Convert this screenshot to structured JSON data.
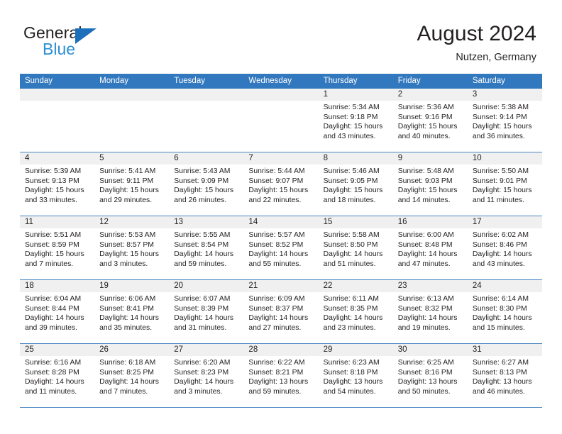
{
  "brand": {
    "name_part1": "General",
    "name_part2": "Blue",
    "triangle_icon": "blue-triangle-icon",
    "colors": {
      "dark": "#231f20",
      "blue": "#2b8fd4",
      "triangle": "#1c6fba"
    }
  },
  "header": {
    "title": "August 2024",
    "subtitle": "Nutzen, Germany"
  },
  "colors": {
    "header_row_bg": "#3278be",
    "header_row_text": "#ffffff",
    "daynum_bg": "#f0f0f0",
    "week_separator": "#4a87c4",
    "cell_text": "#231f20"
  },
  "weekdays": [
    "Sunday",
    "Monday",
    "Tuesday",
    "Wednesday",
    "Thursday",
    "Friday",
    "Saturday"
  ],
  "weeks": [
    {
      "daynums": [
        "",
        "",
        "",
        "",
        "1",
        "2",
        "3"
      ],
      "cells": [
        {
          "day": "",
          "sunrise": "",
          "sunset": "",
          "daylight_line1": "",
          "daylight_line2": ""
        },
        {
          "day": "",
          "sunrise": "",
          "sunset": "",
          "daylight_line1": "",
          "daylight_line2": ""
        },
        {
          "day": "",
          "sunrise": "",
          "sunset": "",
          "daylight_line1": "",
          "daylight_line2": ""
        },
        {
          "day": "",
          "sunrise": "",
          "sunset": "",
          "daylight_line1": "",
          "daylight_line2": ""
        },
        {
          "day": "1",
          "sunrise": "Sunrise: 5:34 AM",
          "sunset": "Sunset: 9:18 PM",
          "daylight_line1": "Daylight: 15 hours",
          "daylight_line2": "and 43 minutes."
        },
        {
          "day": "2",
          "sunrise": "Sunrise: 5:36 AM",
          "sunset": "Sunset: 9:16 PM",
          "daylight_line1": "Daylight: 15 hours",
          "daylight_line2": "and 40 minutes."
        },
        {
          "day": "3",
          "sunrise": "Sunrise: 5:38 AM",
          "sunset": "Sunset: 9:14 PM",
          "daylight_line1": "Daylight: 15 hours",
          "daylight_line2": "and 36 minutes."
        }
      ]
    },
    {
      "daynums": [
        "4",
        "5",
        "6",
        "7",
        "8",
        "9",
        "10"
      ],
      "cells": [
        {
          "day": "4",
          "sunrise": "Sunrise: 5:39 AM",
          "sunset": "Sunset: 9:13 PM",
          "daylight_line1": "Daylight: 15 hours",
          "daylight_line2": "and 33 minutes."
        },
        {
          "day": "5",
          "sunrise": "Sunrise: 5:41 AM",
          "sunset": "Sunset: 9:11 PM",
          "daylight_line1": "Daylight: 15 hours",
          "daylight_line2": "and 29 minutes."
        },
        {
          "day": "6",
          "sunrise": "Sunrise: 5:43 AM",
          "sunset": "Sunset: 9:09 PM",
          "daylight_line1": "Daylight: 15 hours",
          "daylight_line2": "and 26 minutes."
        },
        {
          "day": "7",
          "sunrise": "Sunrise: 5:44 AM",
          "sunset": "Sunset: 9:07 PM",
          "daylight_line1": "Daylight: 15 hours",
          "daylight_line2": "and 22 minutes."
        },
        {
          "day": "8",
          "sunrise": "Sunrise: 5:46 AM",
          "sunset": "Sunset: 9:05 PM",
          "daylight_line1": "Daylight: 15 hours",
          "daylight_line2": "and 18 minutes."
        },
        {
          "day": "9",
          "sunrise": "Sunrise: 5:48 AM",
          "sunset": "Sunset: 9:03 PM",
          "daylight_line1": "Daylight: 15 hours",
          "daylight_line2": "and 14 minutes."
        },
        {
          "day": "10",
          "sunrise": "Sunrise: 5:50 AM",
          "sunset": "Sunset: 9:01 PM",
          "daylight_line1": "Daylight: 15 hours",
          "daylight_line2": "and 11 minutes."
        }
      ]
    },
    {
      "daynums": [
        "11",
        "12",
        "13",
        "14",
        "15",
        "16",
        "17"
      ],
      "cells": [
        {
          "day": "11",
          "sunrise": "Sunrise: 5:51 AM",
          "sunset": "Sunset: 8:59 PM",
          "daylight_line1": "Daylight: 15 hours",
          "daylight_line2": "and 7 minutes."
        },
        {
          "day": "12",
          "sunrise": "Sunrise: 5:53 AM",
          "sunset": "Sunset: 8:57 PM",
          "daylight_line1": "Daylight: 15 hours",
          "daylight_line2": "and 3 minutes."
        },
        {
          "day": "13",
          "sunrise": "Sunrise: 5:55 AM",
          "sunset": "Sunset: 8:54 PM",
          "daylight_line1": "Daylight: 14 hours",
          "daylight_line2": "and 59 minutes."
        },
        {
          "day": "14",
          "sunrise": "Sunrise: 5:57 AM",
          "sunset": "Sunset: 8:52 PM",
          "daylight_line1": "Daylight: 14 hours",
          "daylight_line2": "and 55 minutes."
        },
        {
          "day": "15",
          "sunrise": "Sunrise: 5:58 AM",
          "sunset": "Sunset: 8:50 PM",
          "daylight_line1": "Daylight: 14 hours",
          "daylight_line2": "and 51 minutes."
        },
        {
          "day": "16",
          "sunrise": "Sunrise: 6:00 AM",
          "sunset": "Sunset: 8:48 PM",
          "daylight_line1": "Daylight: 14 hours",
          "daylight_line2": "and 47 minutes."
        },
        {
          "day": "17",
          "sunrise": "Sunrise: 6:02 AM",
          "sunset": "Sunset: 8:46 PM",
          "daylight_line1": "Daylight: 14 hours",
          "daylight_line2": "and 43 minutes."
        }
      ]
    },
    {
      "daynums": [
        "18",
        "19",
        "20",
        "21",
        "22",
        "23",
        "24"
      ],
      "cells": [
        {
          "day": "18",
          "sunrise": "Sunrise: 6:04 AM",
          "sunset": "Sunset: 8:44 PM",
          "daylight_line1": "Daylight: 14 hours",
          "daylight_line2": "and 39 minutes."
        },
        {
          "day": "19",
          "sunrise": "Sunrise: 6:06 AM",
          "sunset": "Sunset: 8:41 PM",
          "daylight_line1": "Daylight: 14 hours",
          "daylight_line2": "and 35 minutes."
        },
        {
          "day": "20",
          "sunrise": "Sunrise: 6:07 AM",
          "sunset": "Sunset: 8:39 PM",
          "daylight_line1": "Daylight: 14 hours",
          "daylight_line2": "and 31 minutes."
        },
        {
          "day": "21",
          "sunrise": "Sunrise: 6:09 AM",
          "sunset": "Sunset: 8:37 PM",
          "daylight_line1": "Daylight: 14 hours",
          "daylight_line2": "and 27 minutes."
        },
        {
          "day": "22",
          "sunrise": "Sunrise: 6:11 AM",
          "sunset": "Sunset: 8:35 PM",
          "daylight_line1": "Daylight: 14 hours",
          "daylight_line2": "and 23 minutes."
        },
        {
          "day": "23",
          "sunrise": "Sunrise: 6:13 AM",
          "sunset": "Sunset: 8:32 PM",
          "daylight_line1": "Daylight: 14 hours",
          "daylight_line2": "and 19 minutes."
        },
        {
          "day": "24",
          "sunrise": "Sunrise: 6:14 AM",
          "sunset": "Sunset: 8:30 PM",
          "daylight_line1": "Daylight: 14 hours",
          "daylight_line2": "and 15 minutes."
        }
      ]
    },
    {
      "daynums": [
        "25",
        "26",
        "27",
        "28",
        "29",
        "30",
        "31"
      ],
      "cells": [
        {
          "day": "25",
          "sunrise": "Sunrise: 6:16 AM",
          "sunset": "Sunset: 8:28 PM",
          "daylight_line1": "Daylight: 14 hours",
          "daylight_line2": "and 11 minutes."
        },
        {
          "day": "26",
          "sunrise": "Sunrise: 6:18 AM",
          "sunset": "Sunset: 8:25 PM",
          "daylight_line1": "Daylight: 14 hours",
          "daylight_line2": "and 7 minutes."
        },
        {
          "day": "27",
          "sunrise": "Sunrise: 6:20 AM",
          "sunset": "Sunset: 8:23 PM",
          "daylight_line1": "Daylight: 14 hours",
          "daylight_line2": "and 3 minutes."
        },
        {
          "day": "28",
          "sunrise": "Sunrise: 6:22 AM",
          "sunset": "Sunset: 8:21 PM",
          "daylight_line1": "Daylight: 13 hours",
          "daylight_line2": "and 59 minutes."
        },
        {
          "day": "29",
          "sunrise": "Sunrise: 6:23 AM",
          "sunset": "Sunset: 8:18 PM",
          "daylight_line1": "Daylight: 13 hours",
          "daylight_line2": "and 54 minutes."
        },
        {
          "day": "30",
          "sunrise": "Sunrise: 6:25 AM",
          "sunset": "Sunset: 8:16 PM",
          "daylight_line1": "Daylight: 13 hours",
          "daylight_line2": "and 50 minutes."
        },
        {
          "day": "31",
          "sunrise": "Sunrise: 6:27 AM",
          "sunset": "Sunset: 8:13 PM",
          "daylight_line1": "Daylight: 13 hours",
          "daylight_line2": "and 46 minutes."
        }
      ]
    }
  ]
}
